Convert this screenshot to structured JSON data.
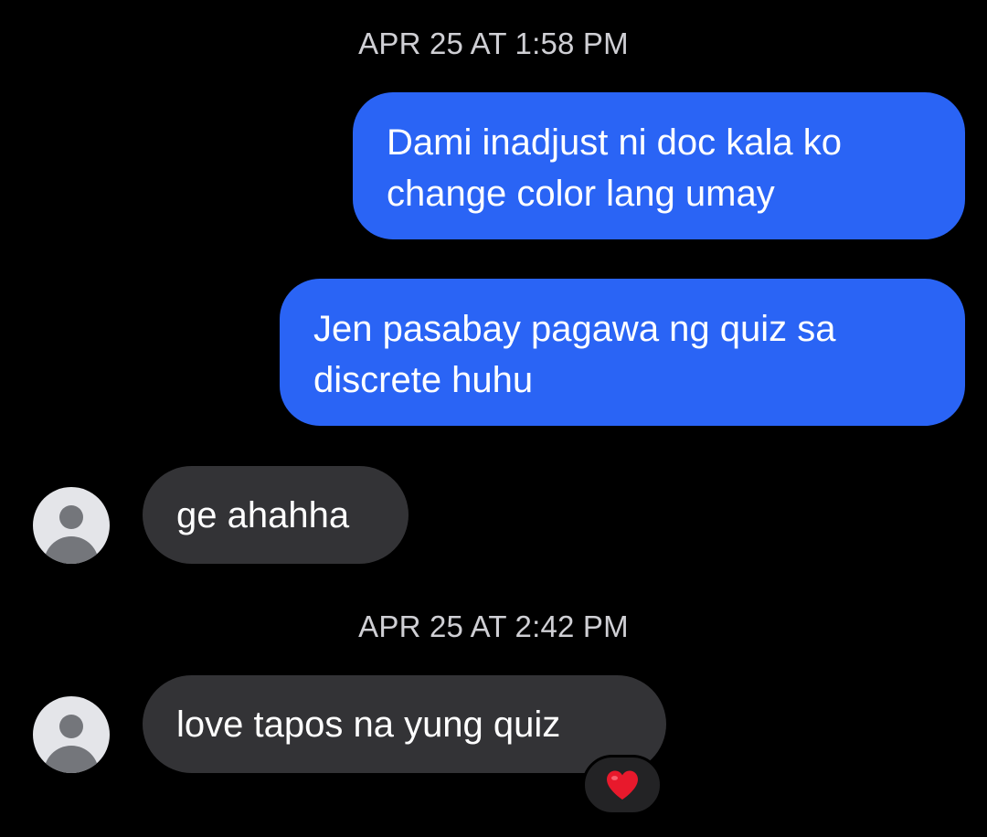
{
  "conversation": {
    "timestamps": [
      "APR 25 AT 1:58 PM",
      "APR 25 AT 2:42 PM"
    ],
    "messages": [
      {
        "direction": "outgoing",
        "lines": [
          "Dami inadjust ni doc kala ko",
          "change color lang umay"
        ]
      },
      {
        "direction": "outgoing",
        "lines": [
          "Jen pasabay pagawa ng quiz sa",
          "discrete huhu"
        ]
      },
      {
        "direction": "incoming",
        "text": "ge ahahha",
        "avatar_icon": "person-icon"
      },
      {
        "direction": "incoming",
        "text": "love tapos na yung quiz",
        "avatar_icon": "person-icon",
        "reaction": "heart-icon"
      }
    ]
  },
  "colors": {
    "background": "#000000",
    "outgoing_bubble": "#2a64f5",
    "incoming_bubble": "#333336",
    "timestamp_text": "#cfcfd4",
    "reaction_heart": "#e8192c"
  }
}
